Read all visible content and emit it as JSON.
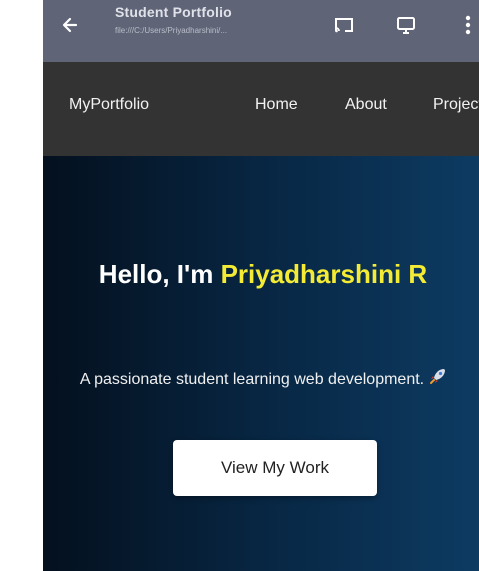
{
  "browser": {
    "title": "Student Portfolio",
    "subtitle": "file:///C:/Users/Priyadharshini/...",
    "icons": [
      "back-arrow-icon",
      "cast-icon",
      "screen-icon",
      "more-vert-icon"
    ]
  },
  "nav": {
    "brand": "MyPortfolio",
    "links": [
      "Home",
      "About",
      "Projects"
    ]
  },
  "hero": {
    "greeting": "Hello, I'm ",
    "name": "Priyadharshini R",
    "tagline": "A passionate student learning web development.",
    "button_label": "View My Work"
  },
  "colors": {
    "topbar": "#5f6476",
    "nav_bg": "#333333",
    "hero_from": "#04101e",
    "hero_to": "#0d3b62",
    "name_accent": "#f4ec34",
    "button_bg": "#ffffff"
  }
}
